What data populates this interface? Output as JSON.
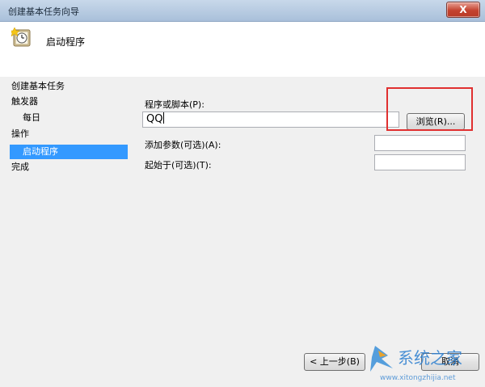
{
  "window": {
    "title": "创建基本任务向导",
    "close_symbol": "X"
  },
  "header": {
    "title": "启动程序"
  },
  "nav": {
    "items": [
      {
        "label": "创建基本任务",
        "selected": false
      },
      {
        "label": "触发器",
        "selected": false
      },
      {
        "label": "每日",
        "selected": false
      },
      {
        "label": "操作",
        "selected": false
      },
      {
        "label": "启动程序",
        "selected": true
      },
      {
        "label": "完成",
        "selected": false
      }
    ]
  },
  "form": {
    "program_label": "程序或脚本(P):",
    "program_value": "QQ",
    "browse_label": "浏览(R)...",
    "args_label": "添加参数(可选)(A):",
    "args_value": "",
    "start_label": "起始于(可选)(T):",
    "start_value": ""
  },
  "footer": {
    "back_label": "< 上一步(B)",
    "cancel_label": "取消"
  },
  "watermark": {
    "brand": "系统之家",
    "url": "www.xitongzhijia.net"
  },
  "colors": {
    "selection": "#3399ff",
    "highlight_border": "#e03030",
    "close_button": "#c4432f"
  }
}
